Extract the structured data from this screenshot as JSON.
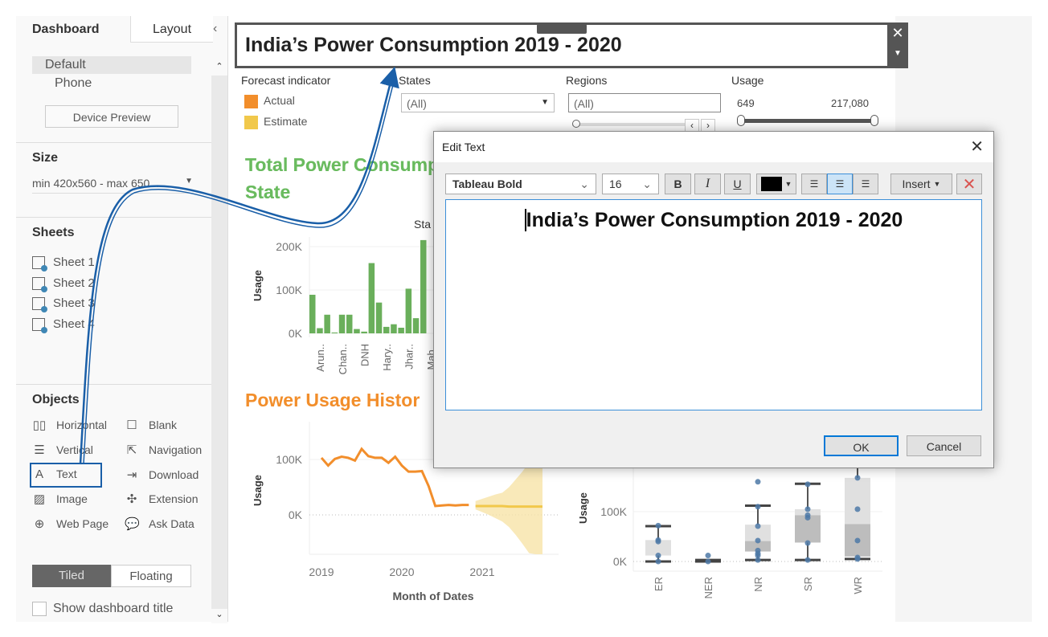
{
  "left_panel": {
    "tabs": [
      "Dashboard",
      "Layout"
    ],
    "collapse_icon": "chevron-left-icon",
    "devices": [
      "Default",
      "Phone"
    ],
    "device_preview": "Device Preview",
    "size_heading": "Size",
    "size_value": "min 420x560 - max 650...",
    "sheets_heading": "Sheets",
    "sheets": [
      "Sheet 1",
      "Sheet 2",
      "Sheet 3",
      "Sheet 4"
    ],
    "objects_heading": "Objects",
    "objects": [
      {
        "label": "Horizontal",
        "icon": "horizontal-container-icon"
      },
      {
        "label": "Blank",
        "icon": "blank-icon"
      },
      {
        "label": "Vertical",
        "icon": "vertical-container-icon"
      },
      {
        "label": "Navigation",
        "icon": "navigation-icon"
      },
      {
        "label": "Text",
        "icon": "text-icon"
      },
      {
        "label": "Download",
        "icon": "download-icon"
      },
      {
        "label": "Image",
        "icon": "image-icon"
      },
      {
        "label": "Extension",
        "icon": "extension-icon"
      },
      {
        "label": "Web Page",
        "icon": "globe-icon"
      },
      {
        "label": "Ask Data",
        "icon": "ask-data-icon"
      }
    ],
    "layout_modes": [
      "Tiled",
      "Floating"
    ],
    "active_mode": "Tiled",
    "show_title_label": "Show dashboard title",
    "show_title_checked": false
  },
  "dashboard": {
    "title": "India’s Power Consumption 2019 - 2020",
    "forecast_legend": {
      "heading": "Forecast indicator",
      "items": [
        {
          "label": "Actual",
          "color": "#f28e2b"
        },
        {
          "label": "Estimate",
          "color": "#f1c84b"
        }
      ]
    },
    "states_filter": {
      "label": "States",
      "value": "(All)"
    },
    "regions_filter": {
      "label": "Regions",
      "value": "(All)"
    },
    "usage_filter": {
      "label": "Usage",
      "min": "649",
      "max": "217,080"
    },
    "bar_title": "Total Power Consumption by State",
    "bar_title_visible": [
      "Total Power Consum",
      "State"
    ],
    "bar_header_partial": "Sta",
    "line_title_visible": "Power Usage Histor",
    "colors": {
      "green": "#6aaf5b",
      "orange": "#f28e2b",
      "estimate": "#f1c84b",
      "band": "#f8e4a8",
      "box_point": "#4e79a7",
      "title_green": "#6abb5f",
      "title_orange": "#f28e2b"
    }
  },
  "chart_data": [
    {
      "type": "bar",
      "ylabel": "Usage",
      "yticks": [
        "0K",
        "100K",
        "200K"
      ],
      "ylim": [
        0,
        230000
      ],
      "values": [
        89000,
        12000,
        43000,
        2000,
        43000,
        43000,
        10000,
        4000,
        162000,
        71000,
        15000,
        21000,
        13000,
        103000,
        35000,
        215000
      ],
      "tick_labels": [
        {
          "index": 1,
          "label": "Arun.."
        },
        {
          "index": 4,
          "label": "Chan.."
        },
        {
          "index": 7,
          "label": "DNH"
        },
        {
          "index": 10,
          "label": "Hary.."
        },
        {
          "index": 13,
          "label": "Jhar.."
        },
        {
          "index": 16,
          "label": "Mah.."
        }
      ]
    },
    {
      "type": "line",
      "xlabel": "Month of Dates",
      "ylabel": "Usage",
      "xticks": [
        "2019",
        "2020",
        "2021"
      ],
      "yticks": [
        "0K",
        "100K"
      ],
      "ylim": [
        -70000,
        160000
      ],
      "actual": {
        "start": "2019-01",
        "values": [
          103000,
          89000,
          101000,
          105000,
          103000,
          98000,
          119000,
          106000,
          103000,
          103000,
          94000,
          105000,
          89000,
          78000,
          78000,
          79000,
          52000,
          16000,
          17000,
          18000,
          17000,
          18000,
          18000
        ]
      },
      "estimate": {
        "start": "2020-12",
        "values": [
          16000,
          16000,
          16000,
          16000,
          16000,
          15000,
          15000,
          15000,
          15000,
          15000,
          15000
        ],
        "upper": [
          25000,
          29000,
          33000,
          37000,
          40000,
          50000,
          64000,
          78000,
          95000,
          115000,
          135000
        ],
        "lower": [
          10000,
          5000,
          0,
          -6000,
          -12000,
          -22000,
          -36000,
          -52000,
          -69000,
          -80000,
          -90000
        ]
      }
    },
    {
      "type": "box",
      "ylabel": "Usage",
      "yticks": [
        "0K",
        "100K"
      ],
      "ylim": [
        -15000,
        175000
      ],
      "categories": [
        "ER",
        "NER",
        "NR",
        "SR",
        "WR"
      ],
      "boxes": [
        {
          "low": 0,
          "q1": 12000,
          "median": 12000,
          "q3": 43000,
          "high": 71000,
          "points": [
            72000,
            43000,
            40000,
            12000,
            0
          ]
        },
        {
          "low": 0,
          "q1": 1000,
          "median": 2000,
          "q3": 3000,
          "high": 3000,
          "points": [
            12000,
            0
          ]
        },
        {
          "low": 3000,
          "q1": 20000,
          "median": 41000,
          "q3": 74000,
          "high": 112000,
          "points": [
            160000,
            110000,
            71000,
            42000,
            22000,
            16000,
            12000,
            3000
          ]
        },
        {
          "low": 3000,
          "q1": 38000,
          "median": 93000,
          "q3": 105000,
          "high": 156000,
          "points": [
            155000,
            105000,
            93000,
            88000,
            37000,
            3000
          ]
        },
        {
          "low": 5000,
          "q1": 10000,
          "median": 75000,
          "q3": 168000,
          "high": 190000,
          "points": [
            168000,
            105000,
            42000,
            8000,
            5000
          ]
        }
      ]
    }
  ],
  "dialog": {
    "title": "Edit Text",
    "font": "Tableau Bold",
    "size": "16",
    "bold": "B",
    "italic": "I",
    "underline": "U",
    "text_color": "#000000",
    "alignment": "center",
    "insert": "Insert",
    "content": "India’s Power Consumption 2019 - 2020",
    "ok": "OK",
    "cancel": "Cancel"
  }
}
